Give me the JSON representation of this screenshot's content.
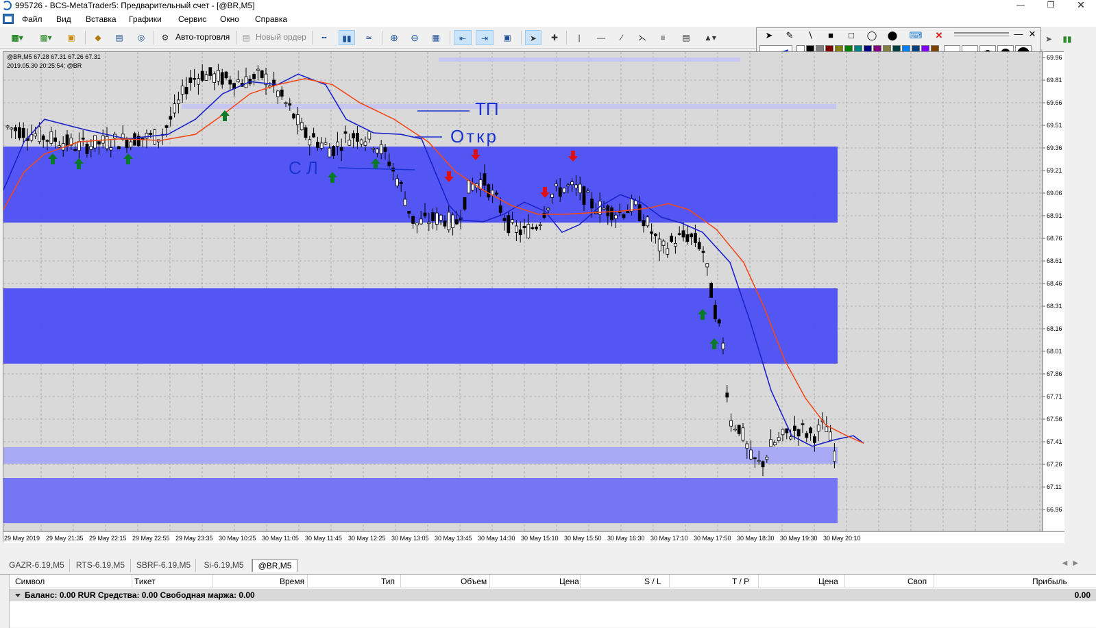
{
  "window": {
    "title": "995726 - BCS-MetaTrader5: Предварительный счет - [@BR,M5]"
  },
  "menu": [
    "Файл",
    "Вид",
    "Вставка",
    "Графики",
    "Сервис",
    "Окно",
    "Справка"
  ],
  "toolbar": {
    "autotrade_label": "Авто-торговля",
    "neworder_label": "Новый ордер"
  },
  "chart": {
    "info_line1": "@BR,M5  67.28 67.31 67.26 67.31",
    "info_line2": "2019.05.30 20:25:54; @BR",
    "price_levels": [
      "69.96",
      "69.81",
      "69.66",
      "69.51",
      "69.36",
      "69.21",
      "69.06",
      "68.91",
      "68.76",
      "68.61",
      "68.46",
      "68.31",
      "68.16",
      "68.01",
      "67.86",
      "67.71",
      "67.56",
      "67.41",
      "67.26",
      "67.11",
      "66.96"
    ],
    "time_labels": [
      "29 May 2019",
      "29 May 21:35",
      "29 May 22:15",
      "29 May 22:55",
      "29 May 23:35",
      "30 May 10:25",
      "30 May 11:05",
      "30 May 11:45",
      "30 May 12:25",
      "30 May 13:05",
      "30 May 13:45",
      "30 May 14:30",
      "30 May 15:10",
      "30 May 15:50",
      "30 May 16:30",
      "30 May 17:10",
      "30 May 17:50",
      "30 May 18:30",
      "30 May 19:30",
      "30 May 20:10"
    ],
    "annotations": {
      "tp": "ТП",
      "open": "Откр",
      "sl": "СЛ"
    },
    "colors": {
      "zone": "#4d4ff5",
      "zone_light": "#a8a9f5",
      "ma_fast": "#1a22c8",
      "ma_slow": "#f04a1a",
      "buy_arrow": "#0a7a2a",
      "sell_arrow": "#e01010",
      "pen": "#1a33d0"
    }
  },
  "tabs": [
    "GAZR-6.19,M5",
    "RTS-6.19,M5",
    "SBRF-6.19,M5",
    "Si-6.19,M5",
    "@BR,M5"
  ],
  "terminal": {
    "columns": [
      "Символ",
      "Тикет",
      "Время",
      "Тип",
      "Объем",
      "Цена",
      "S / L",
      "T / P",
      "Цена",
      "Своп",
      "Прибыль"
    ],
    "balance_text": "Баланс: 0.00 RUR  Средства: 0.00  Свободная маржа: 0.00",
    "profit_total": "0.00"
  }
}
